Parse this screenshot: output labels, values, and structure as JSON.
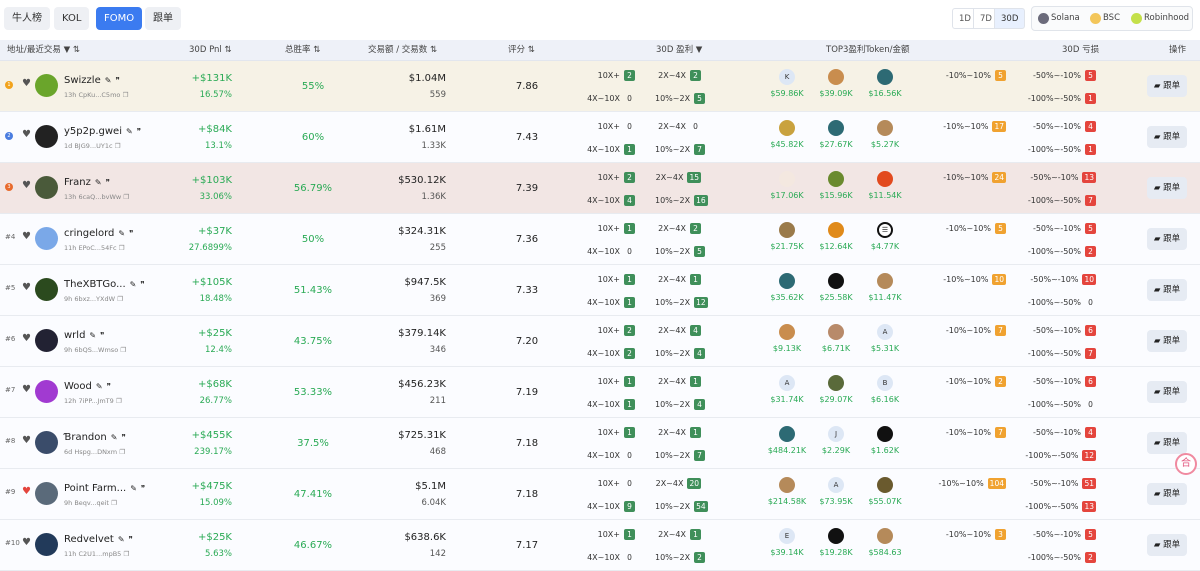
{
  "tabs": [
    {
      "label": "牛人榜",
      "active": false
    },
    {
      "label": "KOL",
      "active": false
    },
    {
      "label": "FOMO",
      "active": true
    },
    {
      "label": "跟单",
      "active": false
    }
  ],
  "periods": [
    {
      "label": "1D",
      "active": false
    },
    {
      "label": "7D",
      "active": false
    },
    {
      "label": "30D",
      "active": true
    }
  ],
  "chains": [
    {
      "label": "Solana",
      "color": "#6b6b7b"
    },
    {
      "label": "BSC",
      "color": "#f3c65a"
    },
    {
      "label": "Robinhood",
      "color": "#c4e04a"
    }
  ],
  "columns": {
    "address": "地址/最近交易",
    "pnl": "30D Pnl",
    "winrate": "总胜率",
    "volume": "交易额 / 交易数",
    "score": "评分",
    "profit_dist": "30D 盈利",
    "top3": "TOP3盈利Token/金额",
    "loss_dist": "30D 亏损",
    "action": "操作"
  },
  "follow_label": "跟单",
  "rows": [
    {
      "rank": "1",
      "name": "Swizzle",
      "time": "13h",
      "addr": "CpKu...C5mo",
      "pnl": "+$131K",
      "pnl_pct": "16.57%",
      "winrate": "55%",
      "volume": "$1.04M",
      "trades": "559",
      "score": "7.86",
      "profit": [
        {
          "label": "10X+",
          "n": "2"
        },
        {
          "label": "2X~4X",
          "n": "2"
        },
        {
          "label": "4X~10X",
          "n": "0"
        },
        {
          "label": "10%~2X",
          "n": "5"
        }
      ],
      "tokens": [
        {
          "icon": "K",
          "value": "$59.86K"
        },
        {
          "icon": "",
          "value": "$39.09K"
        },
        {
          "icon": "",
          "value": "$16.56K"
        }
      ],
      "loss": [
        {
          "label": "-10%~10%",
          "n": "5"
        },
        {
          "label": "-50%~-10%",
          "n": "5"
        },
        {
          "label": "-100%~-50%",
          "n": "1"
        }
      ]
    },
    {
      "rank": "2",
      "name": "y5p2p.gwei",
      "time": "1d",
      "addr": "BJG9...UY1c",
      "pnl": "+$84K",
      "pnl_pct": "13.1%",
      "winrate": "60%",
      "volume": "$1.61M",
      "trades": "1.33K",
      "score": "7.43",
      "profit": [
        {
          "label": "10X+",
          "n": "0"
        },
        {
          "label": "2X~4X",
          "n": "0"
        },
        {
          "label": "4X~10X",
          "n": "1"
        },
        {
          "label": "10%~2X",
          "n": "7"
        }
      ],
      "tokens": [
        {
          "icon": "",
          "value": "$45.82K"
        },
        {
          "icon": "",
          "value": "$27.67K"
        },
        {
          "icon": "",
          "value": "$5.27K"
        }
      ],
      "loss": [
        {
          "label": "-10%~10%",
          "n": "17"
        },
        {
          "label": "-50%~-10%",
          "n": "4"
        },
        {
          "label": "-100%~-50%",
          "n": "1"
        }
      ]
    },
    {
      "rank": "3",
      "name": "Franz",
      "time": "13h",
      "addr": "6caQ...bvWw",
      "pnl": "+$103K",
      "pnl_pct": "33.06%",
      "winrate": "56.79%",
      "volume": "$530.12K",
      "trades": "1.36K",
      "score": "7.39",
      "profit": [
        {
          "label": "10X+",
          "n": "2"
        },
        {
          "label": "2X~4X",
          "n": "15"
        },
        {
          "label": "4X~10X",
          "n": "4"
        },
        {
          "label": "10%~2X",
          "n": "16"
        }
      ],
      "tokens": [
        {
          "icon": "",
          "value": "$17.06K"
        },
        {
          "icon": "",
          "value": "$15.96K"
        },
        {
          "icon": "",
          "value": "$11.54K"
        }
      ],
      "loss": [
        {
          "label": "-10%~10%",
          "n": "24"
        },
        {
          "label": "-50%~-10%",
          "n": "13"
        },
        {
          "label": "-100%~-50%",
          "n": "7"
        }
      ]
    },
    {
      "rank": "#4",
      "name": "cringelord",
      "time": "11h",
      "addr": "EPoC...54Fc",
      "pnl": "+$37K",
      "pnl_pct": "27.6899%",
      "winrate": "50%",
      "volume": "$324.31K",
      "trades": "255",
      "score": "7.36",
      "profit": [
        {
          "label": "10X+",
          "n": "1"
        },
        {
          "label": "2X~4X",
          "n": "2"
        },
        {
          "label": "4X~10X",
          "n": "0"
        },
        {
          "label": "10%~2X",
          "n": "5"
        }
      ],
      "tokens": [
        {
          "icon": "",
          "value": "$21.75K"
        },
        {
          "icon": "",
          "value": "$12.64K"
        },
        {
          "icon": "☰",
          "value": "$4.77K"
        }
      ],
      "loss": [
        {
          "label": "-10%~10%",
          "n": "5"
        },
        {
          "label": "-50%~-10%",
          "n": "5"
        },
        {
          "label": "-100%~-50%",
          "n": "2"
        }
      ]
    },
    {
      "rank": "#5",
      "name": "TheXBTGo...",
      "time": "9h",
      "addr": "6bxz...YXdW",
      "pnl": "+$105K",
      "pnl_pct": "18.48%",
      "winrate": "51.43%",
      "volume": "$947.5K",
      "trades": "369",
      "score": "7.33",
      "profit": [
        {
          "label": "10X+",
          "n": "1"
        },
        {
          "label": "2X~4X",
          "n": "1"
        },
        {
          "label": "4X~10X",
          "n": "1"
        },
        {
          "label": "10%~2X",
          "n": "12"
        }
      ],
      "tokens": [
        {
          "icon": "",
          "value": "$35.62K"
        },
        {
          "icon": "",
          "value": "$25.58K"
        },
        {
          "icon": "",
          "value": "$11.47K"
        }
      ],
      "loss": [
        {
          "label": "-10%~10%",
          "n": "10"
        },
        {
          "label": "-50%~-10%",
          "n": "10"
        },
        {
          "label": "-100%~-50%",
          "n": "0"
        }
      ]
    },
    {
      "rank": "#6",
      "name": "wrld",
      "time": "9h",
      "addr": "6bQS...Wmso",
      "pnl": "+$25K",
      "pnl_pct": "12.4%",
      "winrate": "43.75%",
      "volume": "$379.14K",
      "trades": "346",
      "score": "7.20",
      "profit": [
        {
          "label": "10X+",
          "n": "2"
        },
        {
          "label": "2X~4X",
          "n": "4"
        },
        {
          "label": "4X~10X",
          "n": "2"
        },
        {
          "label": "10%~2X",
          "n": "4"
        }
      ],
      "tokens": [
        {
          "icon": "",
          "value": "$9.13K"
        },
        {
          "icon": "",
          "value": "$6.71K"
        },
        {
          "icon": "A",
          "value": "$5.31K"
        }
      ],
      "loss": [
        {
          "label": "-10%~10%",
          "n": "7"
        },
        {
          "label": "-50%~-10%",
          "n": "6"
        },
        {
          "label": "-100%~-50%",
          "n": "7"
        }
      ]
    },
    {
      "rank": "#7",
      "name": "Wood",
      "time": "12h",
      "addr": "7iPP...JmT9",
      "pnl": "+$68K",
      "pnl_pct": "26.77%",
      "winrate": "53.33%",
      "volume": "$456.23K",
      "trades": "211",
      "score": "7.19",
      "profit": [
        {
          "label": "10X+",
          "n": "1"
        },
        {
          "label": "2X~4X",
          "n": "1"
        },
        {
          "label": "4X~10X",
          "n": "1"
        },
        {
          "label": "10%~2X",
          "n": "4"
        }
      ],
      "tokens": [
        {
          "icon": "A",
          "value": "$31.74K"
        },
        {
          "icon": "",
          "value": "$29.07K"
        },
        {
          "icon": "B",
          "value": "$6.16K"
        }
      ],
      "loss": [
        {
          "label": "-10%~10%",
          "n": "2"
        },
        {
          "label": "-50%~-10%",
          "n": "6"
        },
        {
          "label": "-100%~-50%",
          "n": "0"
        }
      ]
    },
    {
      "rank": "#8",
      "name": "Ɓrandon",
      "time": "6d",
      "addr": "Hspg...DNxm",
      "pnl": "+$455K",
      "pnl_pct": "239.17%",
      "winrate": "37.5%",
      "volume": "$725.31K",
      "trades": "468",
      "score": "7.18",
      "profit": [
        {
          "label": "10X+",
          "n": "1"
        },
        {
          "label": "2X~4X",
          "n": "1"
        },
        {
          "label": "4X~10X",
          "n": "0"
        },
        {
          "label": "10%~2X",
          "n": "7"
        }
      ],
      "tokens": [
        {
          "icon": "",
          "value": "$484.21K"
        },
        {
          "icon": "J",
          "value": "$2.29K"
        },
        {
          "icon": "",
          "value": "$1.62K"
        }
      ],
      "loss": [
        {
          "label": "-10%~10%",
          "n": "7"
        },
        {
          "label": "-50%~-10%",
          "n": "4"
        },
        {
          "label": "-100%~-50%",
          "n": "12"
        }
      ]
    },
    {
      "rank": "#9",
      "name": "Point Farm...",
      "time": "9h",
      "addr": "Beqv...qeit",
      "pnl": "+$475K",
      "pnl_pct": "15.09%",
      "winrate": "47.41%",
      "volume": "$5.1M",
      "trades": "6.04K",
      "score": "7.18",
      "profit": [
        {
          "label": "10X+",
          "n": "0"
        },
        {
          "label": "2X~4X",
          "n": "20"
        },
        {
          "label": "4X~10X",
          "n": "9"
        },
        {
          "label": "10%~2X",
          "n": "54"
        }
      ],
      "tokens": [
        {
          "icon": "",
          "value": "$214.58K"
        },
        {
          "icon": "A",
          "value": "$73.95K"
        },
        {
          "icon": "",
          "value": "$55.07K"
        }
      ],
      "loss": [
        {
          "label": "-10%~10%",
          "n": "104"
        },
        {
          "label": "-50%~-10%",
          "n": "51"
        },
        {
          "label": "-100%~-50%",
          "n": "13"
        }
      ]
    },
    {
      "rank": "#10",
      "name": "Redvelvet",
      "time": "11h",
      "addr": "C2U1...mpB5",
      "pnl": "+$25K",
      "pnl_pct": "5.63%",
      "winrate": "46.67%",
      "volume": "$638.6K",
      "trades": "142",
      "score": "7.17",
      "profit": [
        {
          "label": "10X+",
          "n": "1"
        },
        {
          "label": "2X~4X",
          "n": "1"
        },
        {
          "label": "4X~10X",
          "n": "0"
        },
        {
          "label": "10%~2X",
          "n": "2"
        }
      ],
      "tokens": [
        {
          "icon": "E",
          "value": "$39.14K"
        },
        {
          "icon": "",
          "value": "$19.28K"
        },
        {
          "icon": "",
          "value": "$584.63"
        }
      ],
      "loss": [
        {
          "label": "-10%~10%",
          "n": "3"
        },
        {
          "label": "-50%~-10%",
          "n": "5"
        },
        {
          "label": "-100%~-50%",
          "n": "2"
        }
      ]
    }
  ],
  "fab_label": "合"
}
